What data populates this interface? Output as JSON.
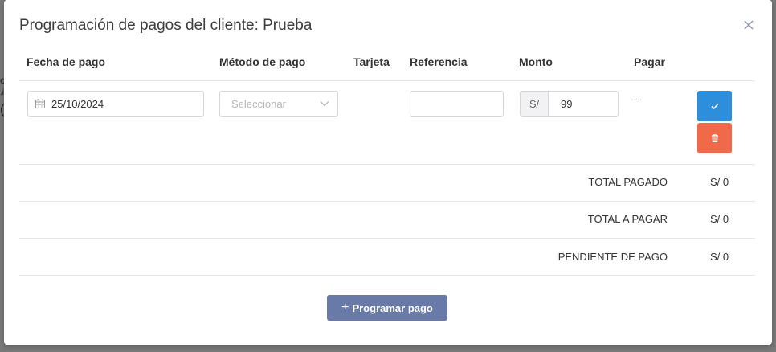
{
  "modal": {
    "title": "Programación de pagos del cliente: Prueba"
  },
  "table": {
    "headers": [
      "Fecha de pago",
      "Método de pago",
      "Tarjeta",
      "Referencia",
      "Monto",
      "Pagar"
    ],
    "row": {
      "date": "25/10/2024",
      "method_placeholder": "Seleccionar",
      "card": "",
      "reference": "",
      "currency_prefix": "S/",
      "amount": "99",
      "pay": "-"
    }
  },
  "summary": [
    {
      "label": "TOTAL PAGADO",
      "value": "S/ 0"
    },
    {
      "label": "TOTAL A PAGAR",
      "value": "S/ 0"
    },
    {
      "label": "PENDIENTE DE PAGO",
      "value": "S/ 0"
    }
  ],
  "actions": {
    "program_label": "Programar pago",
    "program_icon": "plus-icon",
    "confirm_icon": "check-icon",
    "delete_icon": "trash-icon"
  },
  "colors": {
    "confirm": "#2d8fdb",
    "delete": "#f06a4a",
    "primary": "#6a7aa8"
  }
}
